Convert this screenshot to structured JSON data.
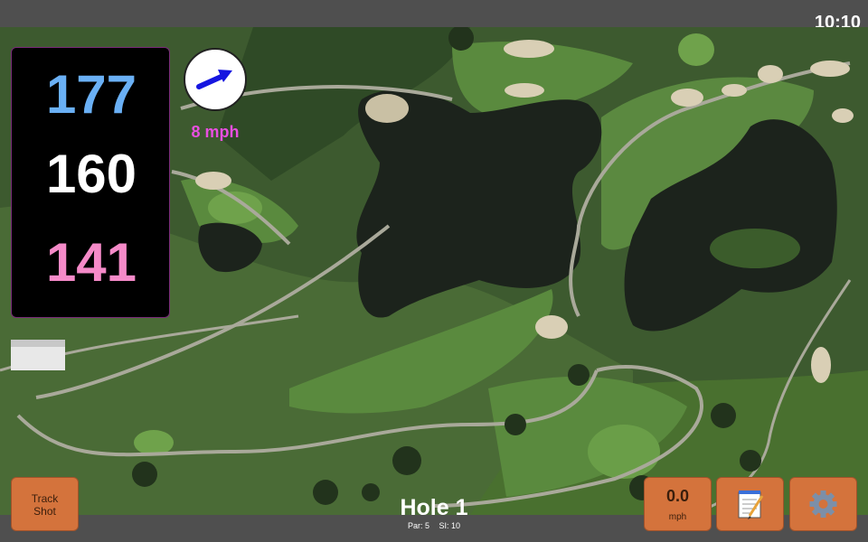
{
  "status": {
    "time": "10:10"
  },
  "distances": {
    "back": "177",
    "center": "160",
    "front": "141"
  },
  "wind": {
    "speed": "8 mph",
    "icon": "wind-direction-arrow-icon"
  },
  "hole": {
    "title": "Hole 1",
    "par": "Par: 5",
    "stroke_index": "SI: 10"
  },
  "buttons": {
    "track_shot_line1": "Track",
    "track_shot_line2": "Shot",
    "speed_value": "0.0",
    "speed_unit": "mph",
    "notes_icon": "notepad-icon",
    "settings_icon": "gear-icon"
  },
  "colors": {
    "back_distance": "#6ab0f5",
    "center_distance": "#ffffff",
    "front_distance": "#f58ac8",
    "wind_text": "#e84fe0",
    "button_bg": "#d4733c",
    "bar_bg": "#4f4f4f"
  }
}
